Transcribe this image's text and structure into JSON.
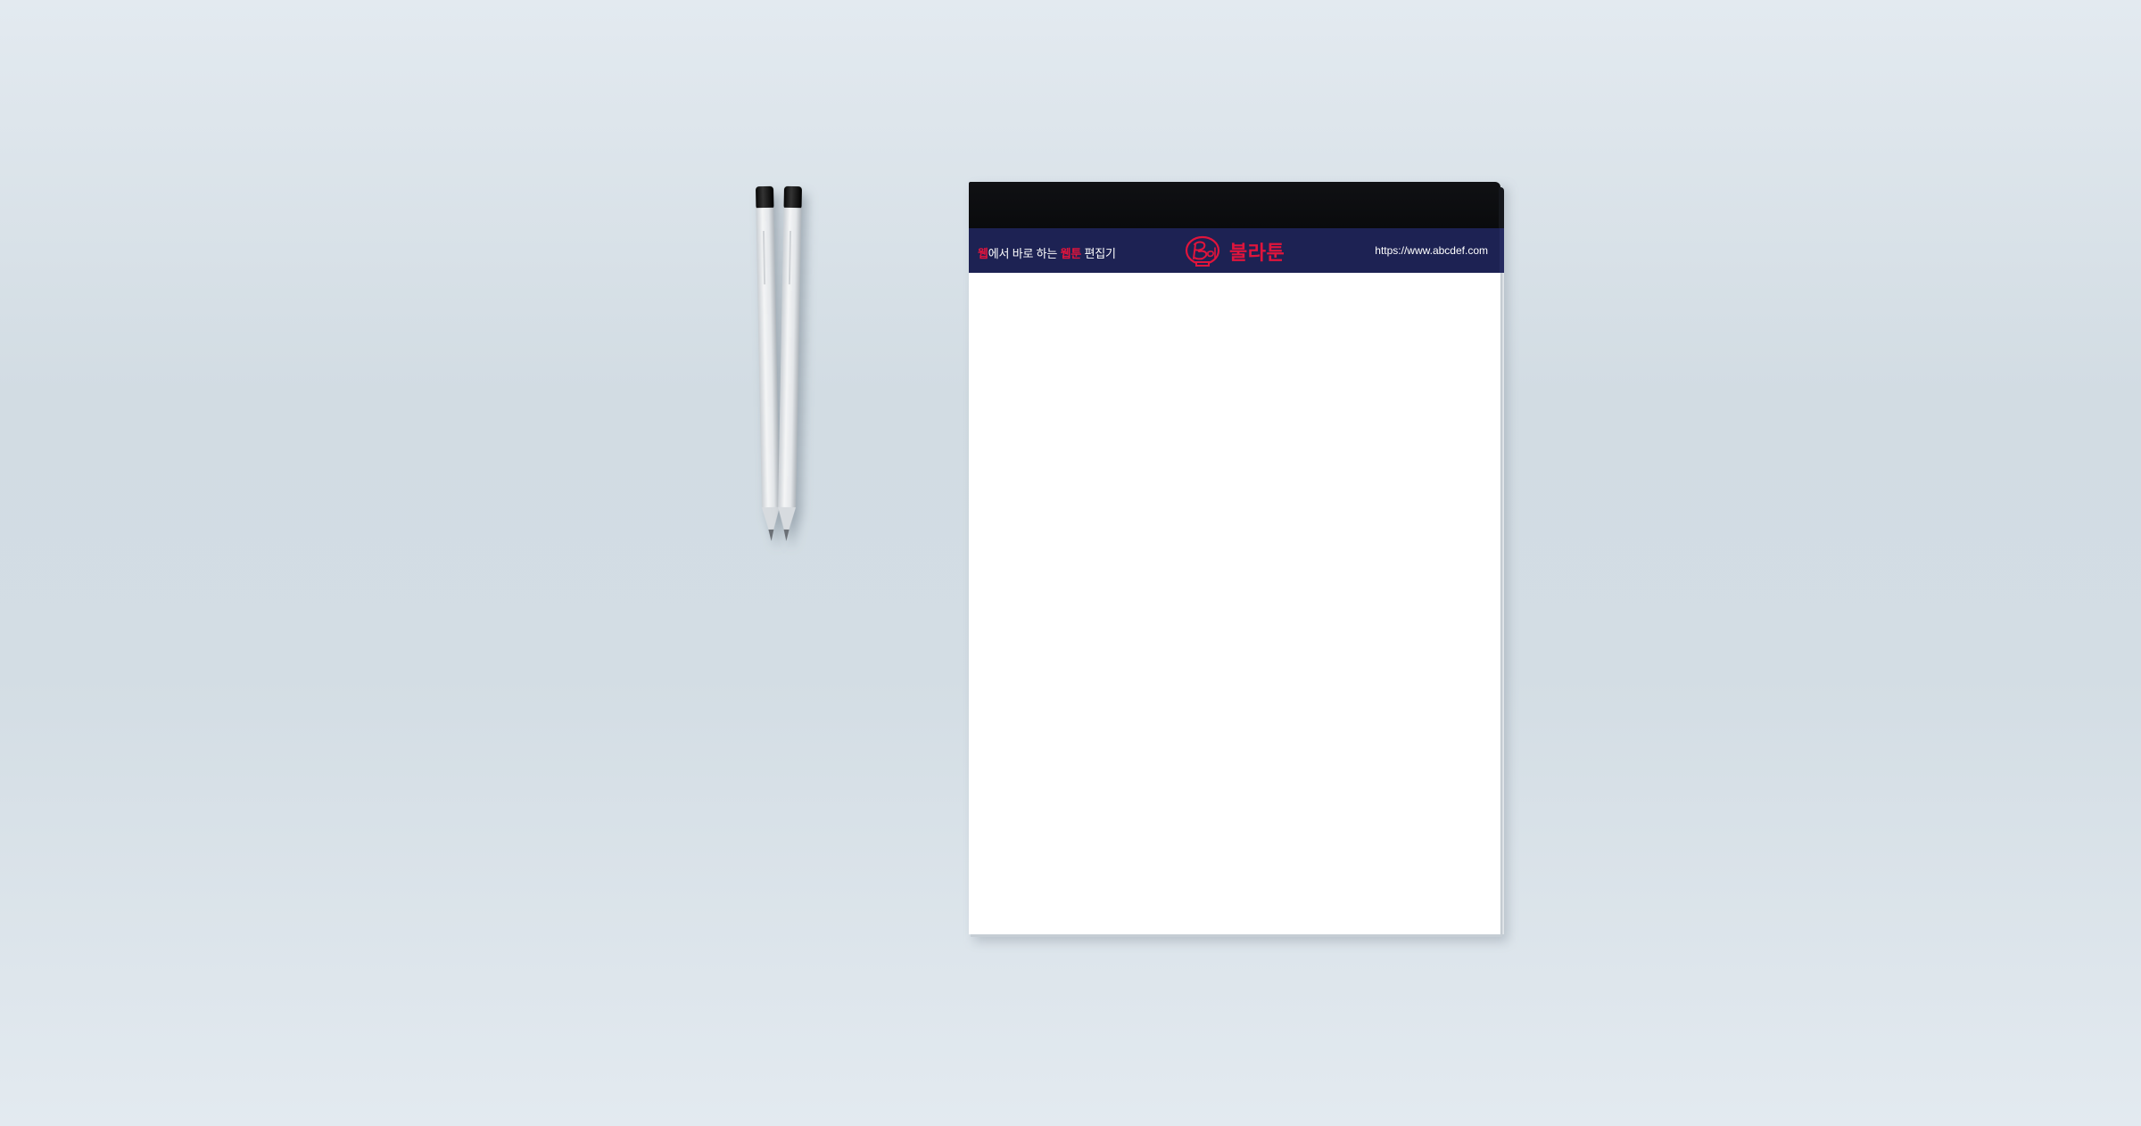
{
  "scene": {
    "colors": {
      "background_light": "#e3eaf0",
      "background_mid": "#d2dce3",
      "header_band": "#1d2253",
      "pad_top": "#0a0b0d",
      "accent": "#e0143c",
      "paper": "#ffffff",
      "pencil_body": "#e9ebed",
      "pencil_cap": "#111111"
    }
  },
  "pencils": [
    {
      "icon": "pencil-icon"
    },
    {
      "icon": "pencil-icon"
    }
  ],
  "notepad": {
    "header": {
      "tagline": {
        "accent_1": "웹",
        "plain_1": "에서 바로 하는 ",
        "accent_2": "웹툰",
        "plain_2": " 편집기"
      },
      "logo": {
        "icon": "bootoon-logo-icon",
        "name": "불라툰"
      },
      "url": "https://www.abcdef.com"
    }
  }
}
